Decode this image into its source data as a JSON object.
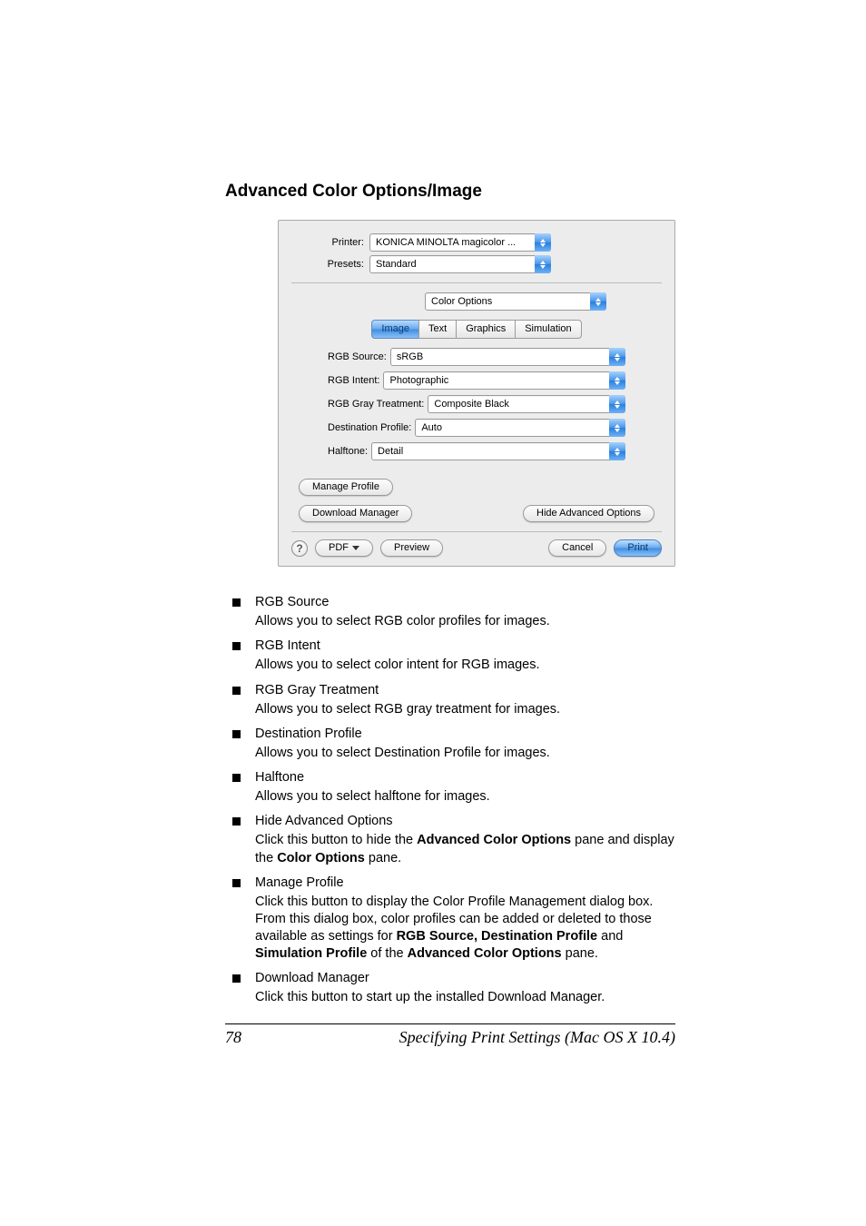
{
  "heading": "Advanced Color Options/Image",
  "dialog": {
    "printer_label": "Printer:",
    "printer_value": "KONICA MINOLTA magicolor ...",
    "presets_label": "Presets:",
    "presets_value": "Standard",
    "panel_value": "Color Options",
    "tabs": [
      "Image",
      "Text",
      "Graphics",
      "Simulation"
    ],
    "active_tab_index": 0,
    "fields": [
      {
        "label": "RGB Source:",
        "value": "sRGB"
      },
      {
        "label": "RGB Intent:",
        "value": "Photographic"
      },
      {
        "label": "RGB Gray Treatment:",
        "value": "Composite Black"
      },
      {
        "label": "Destination Profile:",
        "value": "Auto"
      },
      {
        "label": "Halftone:",
        "value": "Detail"
      }
    ],
    "manage_profile": "Manage Profile",
    "download_manager": "Download Manager",
    "hide_adv": "Hide Advanced Options",
    "help": "?",
    "pdf": "PDF",
    "preview": "Preview",
    "cancel": "Cancel",
    "print": "Print"
  },
  "bullets": {
    "rgb_source_t": "RGB Source",
    "rgb_source_d": "Allows you to select RGB color profiles for images.",
    "rgb_intent_t": "RGB Intent",
    "rgb_intent_d": "Allows you to select color intent for RGB images.",
    "rgb_gray_t": "RGB Gray Treatment",
    "rgb_gray_d": "Allows you to select RGB gray treatment for images.",
    "dest_t": "Destination Profile",
    "dest_d": "Allows you to select Destination Profile for images.",
    "halftone_t": "Halftone",
    "halftone_d": "Allows you to select halftone for images.",
    "hide_t": "Hide Advanced Options",
    "hide_d1": "Click this button to hide the ",
    "hide_b1": "Advanced Color Options",
    "hide_d2": " pane and display the ",
    "hide_b2": "Color Options",
    "hide_d3": " pane.",
    "manage_t": "Manage Profile",
    "manage_d1": "Click this button to display the Color Profile Management dialog box. From this dialog box, color profiles can be added or deleted to those available as settings for ",
    "manage_b1": "RGB Source, Destination Profile",
    "manage_d2": " and ",
    "manage_b2": "Simulation Profile",
    "manage_d3": " of the ",
    "manage_b3": "Advanced Color Options",
    "manage_d4": " pane.",
    "dl_t": "Download Manager",
    "dl_d": "Click this button to start up the installed Download Manager."
  },
  "footer": {
    "page": "78",
    "text": "Specifying Print Settings (Mac OS X 10.4)"
  }
}
